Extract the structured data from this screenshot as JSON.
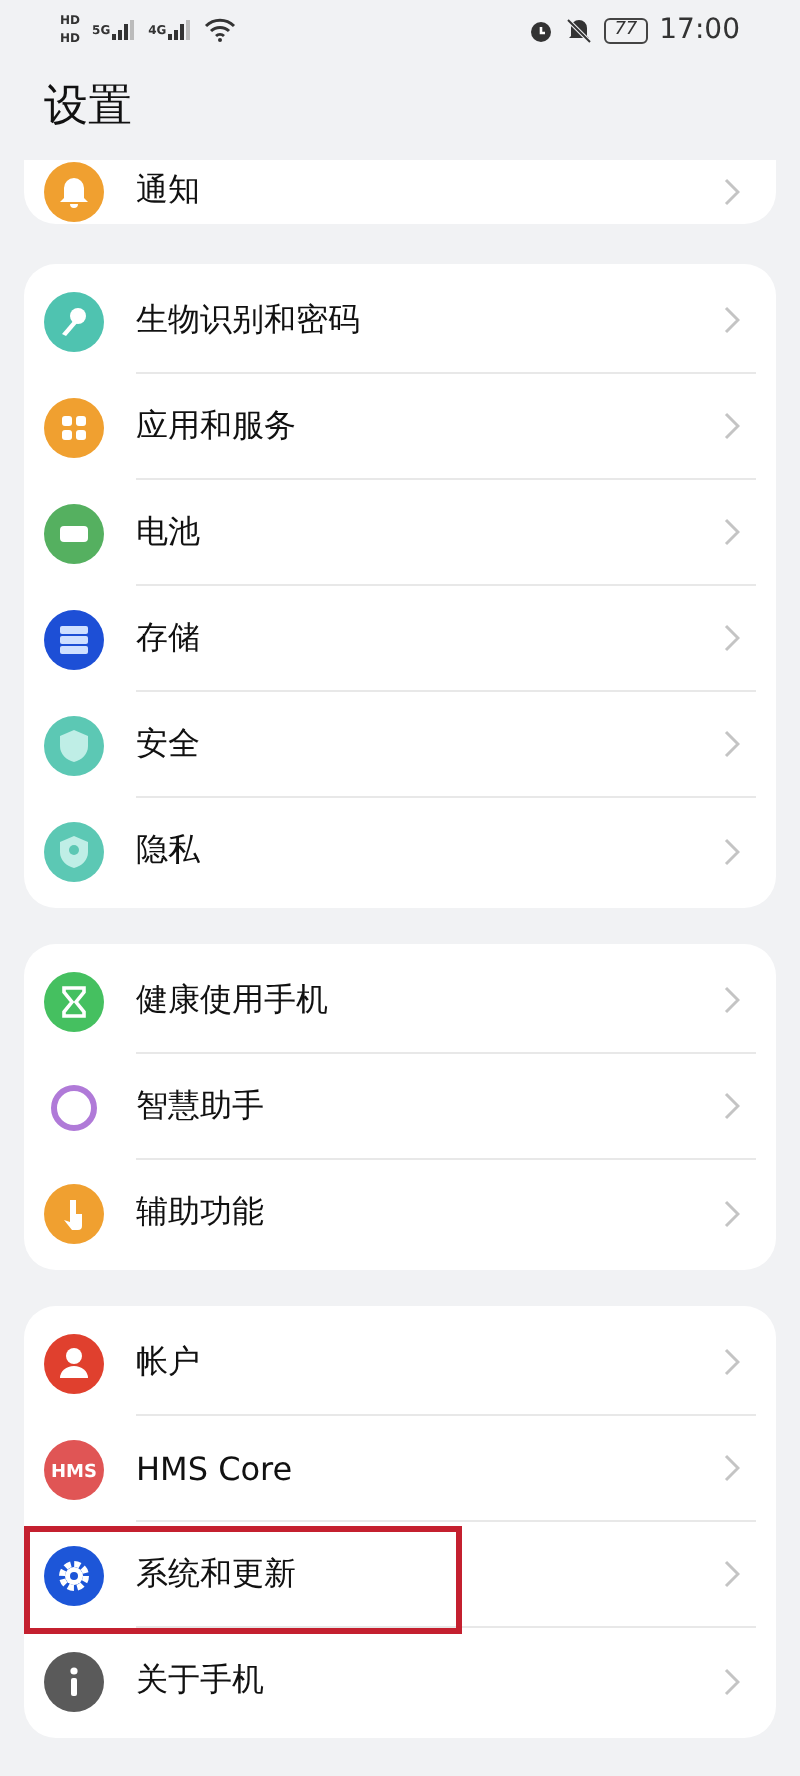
{
  "status_bar": {
    "sim_labels": [
      "HD",
      "HD"
    ],
    "networks": [
      "5G",
      "4G"
    ],
    "battery": "77",
    "time": "17:00"
  },
  "title": "设置",
  "groups": [
    {
      "items": [
        {
          "kind": "bell",
          "label": "通知",
          "highlighted": false
        }
      ]
    },
    {
      "items": [
        {
          "kind": "key",
          "label": "生物识别和密码",
          "highlighted": false
        },
        {
          "kind": "apps",
          "label": "应用和服务",
          "highlighted": false
        },
        {
          "kind": "battery",
          "label": "电池",
          "highlighted": false
        },
        {
          "kind": "storage",
          "label": "存储",
          "highlighted": false
        },
        {
          "kind": "shield",
          "label": "安全",
          "highlighted": false
        },
        {
          "kind": "privacy",
          "label": "隐私",
          "highlighted": false
        }
      ]
    },
    {
      "items": [
        {
          "kind": "hourglass",
          "label": "健康使用手机",
          "highlighted": false
        },
        {
          "kind": "ring",
          "label": "智慧助手",
          "highlighted": false
        },
        {
          "kind": "hand",
          "label": "辅助功能",
          "highlighted": false
        }
      ]
    },
    {
      "items": [
        {
          "kind": "person",
          "label": "帐户",
          "highlighted": false
        },
        {
          "kind": "hms",
          "icon_text": "HMS",
          "label": "HMS Core",
          "highlighted": false
        },
        {
          "kind": "gear",
          "label": "系统和更新",
          "highlighted": true
        },
        {
          "kind": "info",
          "label": "关于手机",
          "highlighted": false
        }
      ]
    }
  ]
}
